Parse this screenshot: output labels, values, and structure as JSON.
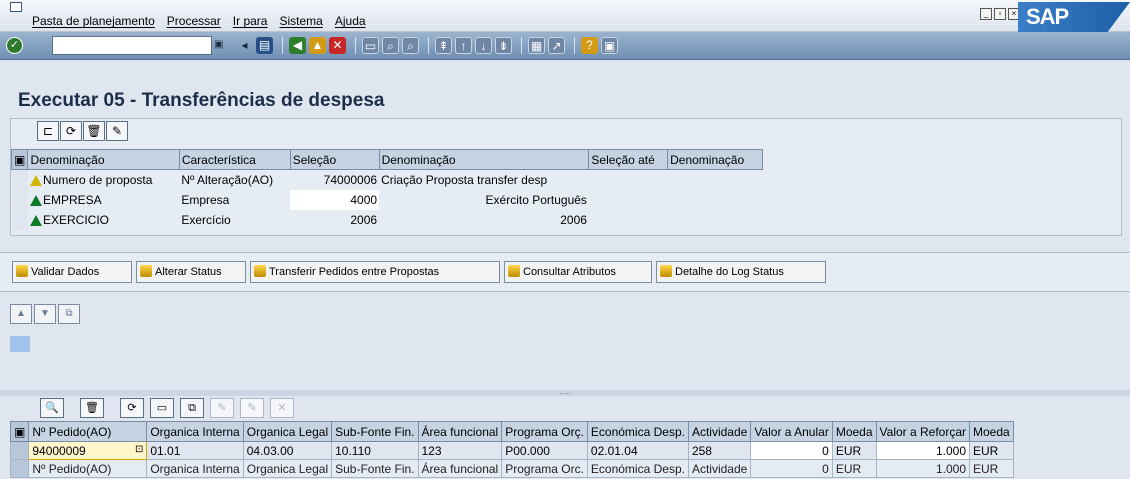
{
  "menu": {
    "items": [
      "Pasta de planejamento",
      "Processar",
      "Ir para",
      "Sistema",
      "Ajuda"
    ]
  },
  "brand": {
    "logo_text": "SAP"
  },
  "page": {
    "title": "Executar 05 - Transferências de despesa"
  },
  "selection": {
    "headers": [
      "Denominação",
      "Característica",
      "Seleção",
      "Denominação",
      "Seleção até",
      "Denominação"
    ],
    "rows": [
      [
        "Numero de proposta",
        "Nº Alteração(AO)",
        "74000006",
        "Criação Proposta",
        "transfer desp",
        ""
      ],
      [
        "EMPRESA",
        "Empresa",
        "4000",
        "Exército Português",
        "",
        ""
      ],
      [
        "EXERCICIO",
        "Exercício",
        "2006",
        "2006",
        "",
        ""
      ]
    ]
  },
  "actions": [
    "Validar Dados",
    "Alterar Status",
    "Transferir Pedidos entre Propostas",
    "Consultar Atributos",
    "Detalhe do Log Status"
  ],
  "splitter_text": ".....",
  "orders": {
    "headers": [
      "Nº Pedido(AO)",
      "Organica Interna",
      "Organica Legal",
      "Sub-Fonte Fin.",
      "Área funcional",
      "Programa Orç.",
      "Económica Desp.",
      "Actividade",
      "Valor a Anular",
      "Moeda",
      "Valor a Reforçar",
      "Moeda"
    ],
    "row": [
      "94000009",
      "01.01",
      "04.03.00",
      "10.110",
      "123",
      "P00.000",
      "02.01.04",
      "258",
      "0",
      "EUR",
      "1.000",
      "EUR"
    ],
    "repeat_row": [
      "Nº Pedido(AO)",
      "Organica Interna",
      "Organica Legal",
      "Sub-Fonte Fin.",
      "Área funcional",
      "Programa Orc.",
      "Económica Desp.",
      "Actividade",
      "0",
      "EUR",
      "1.000",
      "EUR"
    ]
  },
  "colors": {
    "toolbar": "#7f9cbf",
    "title": "#1c2e4a",
    "background": "#dfe6ef"
  }
}
